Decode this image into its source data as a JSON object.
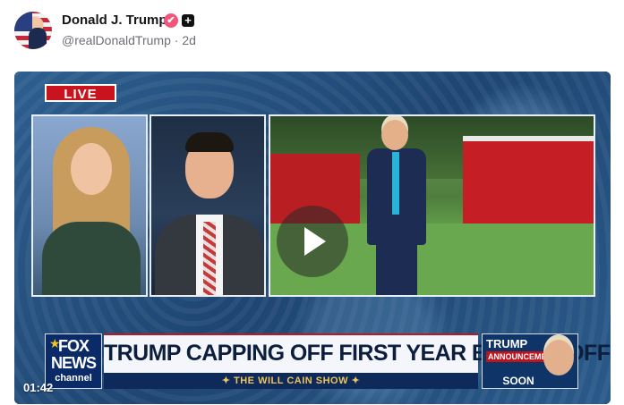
{
  "post": {
    "author_name": "Donald J. Trump",
    "verified_icon": "✔",
    "add_icon": "+",
    "handle": "@realDonaldTrump",
    "separator": " · ",
    "age": "2d"
  },
  "video": {
    "live_badge": "LIVE",
    "headline": "TRUMP CAPPING OFF FIRST YEAR BACK IN OFFICE",
    "show_name": "✦ THE WILL CAIN SHOW ✦",
    "network_line1": "FOX",
    "network_line2": "NEWS",
    "network_line3": "channel",
    "promo_line1": "TRUMP",
    "promo_line2": "ANNOUNCEMENT",
    "promo_line3": "SOON",
    "elapsed_time": "01:42",
    "play_icon": "play-icon"
  },
  "colors": {
    "verified": "#f2557a",
    "live": "#c9141f"
  }
}
